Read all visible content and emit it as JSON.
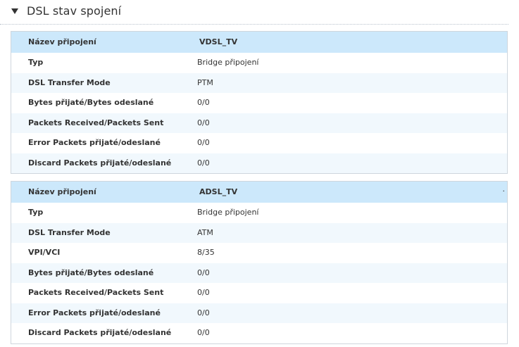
{
  "section": {
    "title": "DSL stav spojení",
    "caret_icon": "caret-down-icon"
  },
  "connections": [
    {
      "header_label": "Název připojení",
      "name": "VDSL_TV",
      "rows": [
        {
          "label": "Typ",
          "value": "Bridge připojení"
        },
        {
          "label": "DSL Transfer Mode",
          "value": "PTM"
        },
        {
          "label": "Bytes přijaté/Bytes odeslané",
          "value": "0/0"
        },
        {
          "label": "Packets Received/Packets Sent",
          "value": "0/0"
        },
        {
          "label": "Error Packets přijaté/odeslané",
          "value": "0/0"
        },
        {
          "label": "Discard Packets přijaté/odeslané",
          "value": "0/0"
        }
      ]
    },
    {
      "header_label": "Název připojení",
      "name": "ADSL_TV",
      "header_mark": "·",
      "rows": [
        {
          "label": "Typ",
          "value": "Bridge připojení"
        },
        {
          "label": "DSL Transfer Mode",
          "value": "ATM"
        },
        {
          "label": "VPI/VCI",
          "value": "8/35"
        },
        {
          "label": "Bytes přijaté/Bytes odeslané",
          "value": "0/0"
        },
        {
          "label": "Packets Received/Packets Sent",
          "value": "0/0"
        },
        {
          "label": "Error Packets přijaté/odeslané",
          "value": "0/0"
        },
        {
          "label": "Discard Packets přijaté/odeslané",
          "value": "0/0"
        }
      ]
    }
  ],
  "colors": {
    "header_bg": "#cce8fb",
    "alt_row_bg": "#f1f8fd",
    "border": "#cfd6dd"
  }
}
